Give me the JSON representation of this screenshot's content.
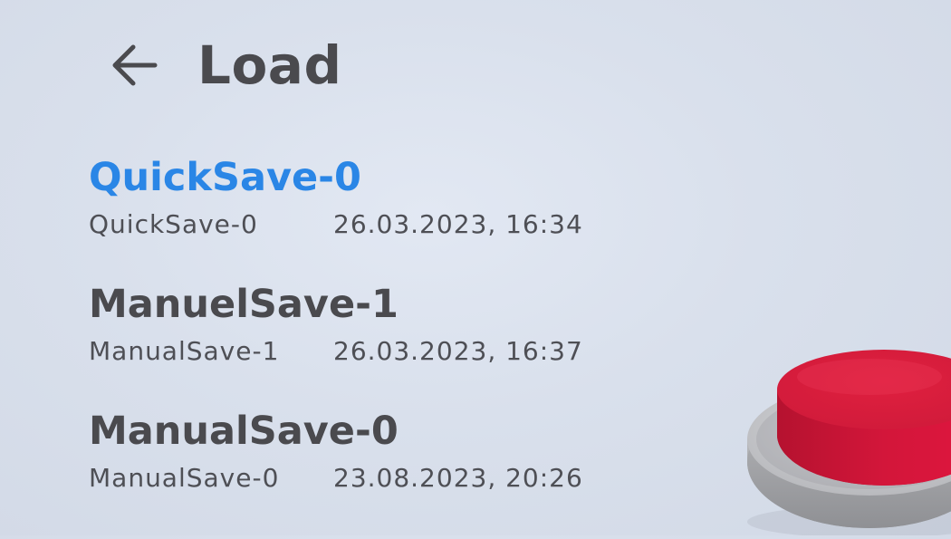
{
  "header": {
    "title": "Load",
    "back_icon": "arrow-left-icon"
  },
  "saves": [
    {
      "title": "QuickSave-0",
      "name": "QuickSave-0",
      "datetime": "26.03.2023, 16:34",
      "selected": true
    },
    {
      "title": "ManuelSave-1",
      "name": "ManualSave-1",
      "datetime": "26.03.2023, 16:37",
      "selected": false
    },
    {
      "title": "ManualSave-0",
      "name": "ManualSave-0",
      "datetime": "23.08.2023, 20:26",
      "selected": false
    }
  ],
  "colors": {
    "selected_title": "#2a86e6",
    "text": "#4a4a4e",
    "button_red": "#e0163f",
    "button_base": "#c8c9cc"
  },
  "decorations": {
    "big_button": "red-push-button-icon"
  }
}
